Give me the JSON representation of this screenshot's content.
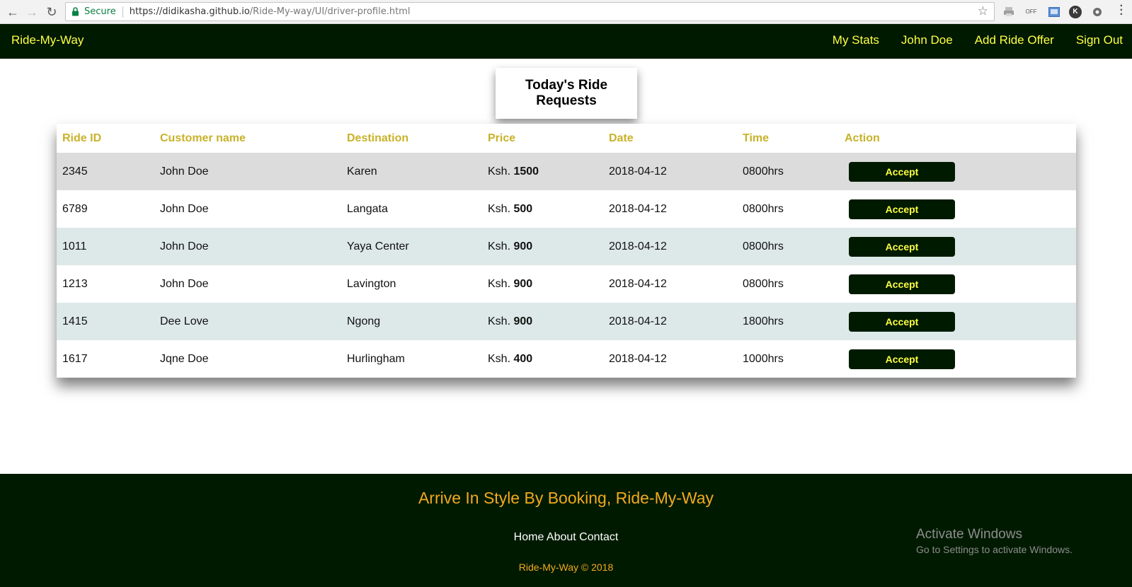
{
  "browser": {
    "secure_label": "Secure",
    "url_host": "https://didikasha.github.io",
    "url_path": "/Ride-My-way/UI/driver-profile.html",
    "extensions": [
      "printer-icon",
      "off-icon",
      "screenshot-icon",
      "k-icon",
      "settings-icon"
    ],
    "k_label": "K",
    "off_label": "OFF"
  },
  "navbar": {
    "brand": "Ride-My-Way",
    "links": [
      "My Stats",
      "John Doe",
      "Add Ride Offer",
      "Sign Out"
    ]
  },
  "title_card": "Today's Ride Requests",
  "table": {
    "headers": [
      "Ride ID",
      "Customer name",
      "Destination",
      "Price",
      "Date",
      "Time",
      "Action"
    ],
    "rows": [
      {
        "id": "2345",
        "customer": "John Doe",
        "destination": "Karen",
        "currency": "Ksh.",
        "amount": "1500",
        "date": "2018-04-12",
        "time": "0800hrs",
        "action": "Accept"
      },
      {
        "id": "6789",
        "customer": "John Doe",
        "destination": "Langata",
        "currency": "Ksh.",
        "amount": "500",
        "date": "2018-04-12",
        "time": "0800hrs",
        "action": "Accept"
      },
      {
        "id": "1011",
        "customer": "John Doe",
        "destination": "Yaya Center",
        "currency": "Ksh.",
        "amount": "900",
        "date": "2018-04-12",
        "time": "0800hrs",
        "action": "Accept"
      },
      {
        "id": "1213",
        "customer": "John Doe",
        "destination": "Lavington",
        "currency": "Ksh.",
        "amount": "900",
        "date": "2018-04-12",
        "time": "0800hrs",
        "action": "Accept"
      },
      {
        "id": "1415",
        "customer": "Dee Love",
        "destination": "Ngong",
        "currency": "Ksh.",
        "amount": "900",
        "date": "2018-04-12",
        "time": "1800hrs",
        "action": "Accept"
      },
      {
        "id": "1617",
        "customer": "Jqne Doe",
        "destination": "Hurlingham",
        "currency": "Ksh.",
        "amount": "400",
        "date": "2018-04-12",
        "time": "1000hrs",
        "action": "Accept"
      }
    ]
  },
  "footer": {
    "tagline": "Arrive In Style By Booking, Ride-My-Way",
    "links": "Home About Contact",
    "copyright": "Ride-My-Way © 2018"
  },
  "watermark": {
    "title": "Activate Windows",
    "subtitle": "Go to Settings to activate Windows."
  },
  "colors": {
    "brand_dark": "#001a00",
    "nav_text": "#ffff44",
    "header_text": "#c8b22a",
    "footer_accent": "#f2a91e"
  }
}
